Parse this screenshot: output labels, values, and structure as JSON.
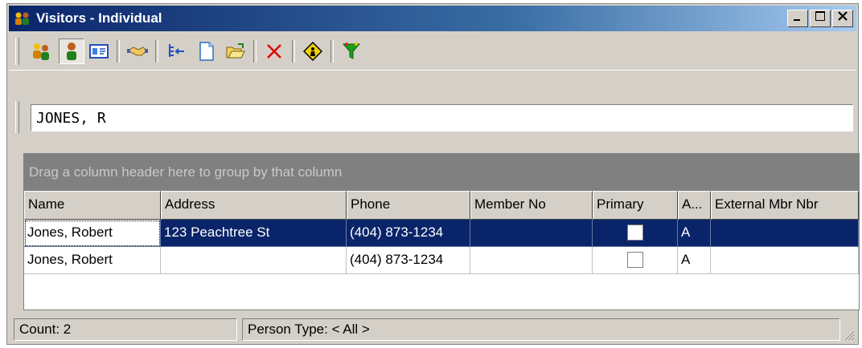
{
  "window": {
    "title": "Visitors - Individual",
    "minimize_label": "_",
    "maximize_label": "□",
    "close_label": "×"
  },
  "toolbar": {
    "icons": [
      "people-icon",
      "person-icon",
      "card-icon",
      "handshake-icon",
      "tree-icon",
      "new-document-icon",
      "open-folder-icon",
      "delete-icon",
      "warning-sign-icon",
      "filter-funnel-icon"
    ],
    "colors": {
      "delete": "#e00000",
      "filter": "#18a018",
      "warning": "#f0d000"
    }
  },
  "search": {
    "value": "JONES, R"
  },
  "grid": {
    "group_hint": "Drag a column header here to group by that column",
    "columns": [
      "Name",
      "Address",
      "Phone",
      "Member No",
      "Primary",
      "A...",
      "External Mbr Nbr"
    ],
    "rows": [
      {
        "name": "Jones, Robert",
        "address": "123 Peachtree St",
        "phone": "(404) 873-1234",
        "member_no": "",
        "primary": false,
        "a": "A",
        "external": "",
        "selected": true
      },
      {
        "name": "Jones, Robert",
        "address": "",
        "phone": "(404) 873-1234",
        "member_no": "",
        "primary": false,
        "a": "A",
        "external": "",
        "selected": false
      }
    ],
    "selection_color": "#0a246a"
  },
  "status": {
    "count": "Count: 2",
    "person_type": "Person Type: < All >"
  }
}
